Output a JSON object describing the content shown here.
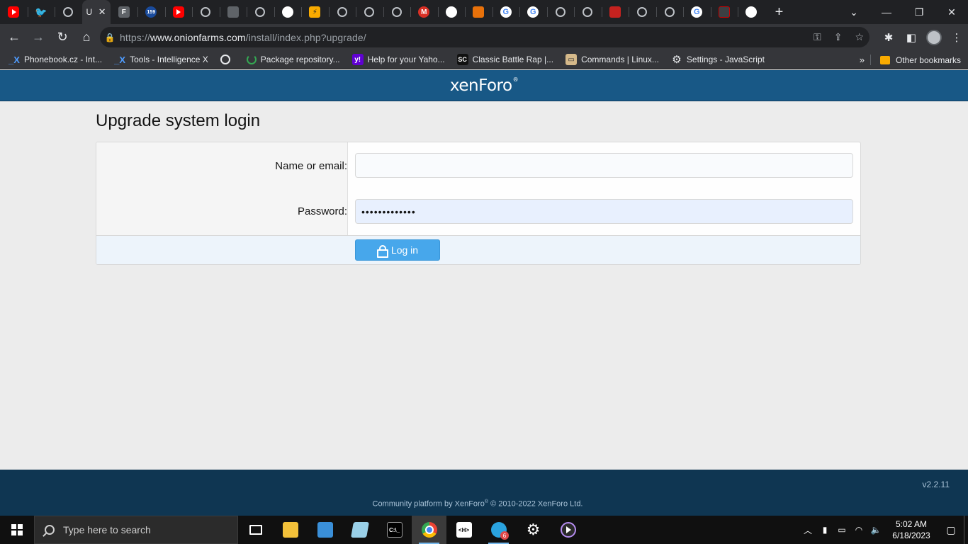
{
  "browser": {
    "url_prefix": "https://",
    "url_host": "www.onionfarms.com",
    "url_path": "/install/index.php?upgrade/",
    "active_tab_letter": "U",
    "new_tab_glyph": "+",
    "tabs": [
      {
        "icon": "youtube-icon",
        "text": ""
      },
      {
        "icon": "twitter-icon",
        "text": "🐦"
      },
      {
        "icon": "globe-icon",
        "text": ""
      },
      {
        "icon": "active",
        "text": ""
      },
      {
        "icon": "app-icon",
        "text": "F"
      },
      {
        "icon": "counter-icon",
        "text": "159"
      },
      {
        "icon": "youtube-icon",
        "text": ""
      },
      {
        "icon": "globe-icon",
        "text": ""
      },
      {
        "icon": "image-icon",
        "text": ""
      },
      {
        "icon": "globe-icon",
        "text": ""
      },
      {
        "icon": "github-icon",
        "text": ""
      },
      {
        "icon": "yellow-icon",
        "text": "⚡"
      },
      {
        "icon": "globe-icon",
        "text": ""
      },
      {
        "icon": "globe-icon",
        "text": ""
      },
      {
        "icon": "globe-icon",
        "text": ""
      },
      {
        "icon": "m-icon",
        "text": "M"
      },
      {
        "icon": "github-icon",
        "text": ""
      },
      {
        "icon": "rss-icon",
        "text": ""
      },
      {
        "icon": "google-icon",
        "text": "G"
      },
      {
        "icon": "google-icon",
        "text": "G"
      },
      {
        "icon": "globe-icon",
        "text": ""
      },
      {
        "icon": "globe-icon",
        "text": ""
      },
      {
        "icon": "lock-icon",
        "text": ""
      },
      {
        "icon": "globe-icon",
        "text": ""
      },
      {
        "icon": "globe-icon",
        "text": ""
      },
      {
        "icon": "google-icon",
        "text": "G"
      },
      {
        "icon": "dark-icon",
        "text": ""
      },
      {
        "icon": "github-icon",
        "text": ""
      }
    ]
  },
  "bookmarks": {
    "items": [
      {
        "icon": "intelligence-x-icon",
        "glyph": "_X",
        "label": "Phonebook.cz - Int..."
      },
      {
        "icon": "intelligence-x-icon",
        "glyph": "_X",
        "label": "Tools - Intelligence X"
      },
      {
        "icon": "globe-icon",
        "glyph": "",
        "label": ""
      },
      {
        "icon": "ring-icon",
        "glyph": "",
        "label": "Package repository..."
      },
      {
        "icon": "yahoo-icon",
        "glyph": "y!",
        "label": "Help for your Yaho..."
      },
      {
        "icon": "sc-icon",
        "glyph": "SC",
        "label": "Classic Battle Rap |..."
      },
      {
        "icon": "commands-icon",
        "glyph": "▭",
        "label": "Commands | Linux..."
      },
      {
        "icon": "gear-icon",
        "glyph": "⚙",
        "label": "Settings - JavaScript"
      }
    ],
    "more": "»",
    "other": "Other bookmarks"
  },
  "page": {
    "logo_xen": "xen",
    "logo_foro": "Foro",
    "logo_mark": "®",
    "title": "Upgrade system login",
    "name_label": "Name or email:",
    "name_value": "",
    "password_label": "Password:",
    "password_value": "•••••••••••••",
    "login_button": "Log in",
    "version": "v2.2.11",
    "copyright_pre": "Community platform by XenForo",
    "copyright_mark": "®",
    "copyright_post": " © 2010-2022 XenForo Ltd."
  },
  "taskbar": {
    "search_placeholder": "Type here to search",
    "cmd_glyph": "C:\\_",
    "http_glyph": "<H>",
    "telegram_badge": "6",
    "time": "5:02 AM",
    "date": "6/18/2023"
  }
}
